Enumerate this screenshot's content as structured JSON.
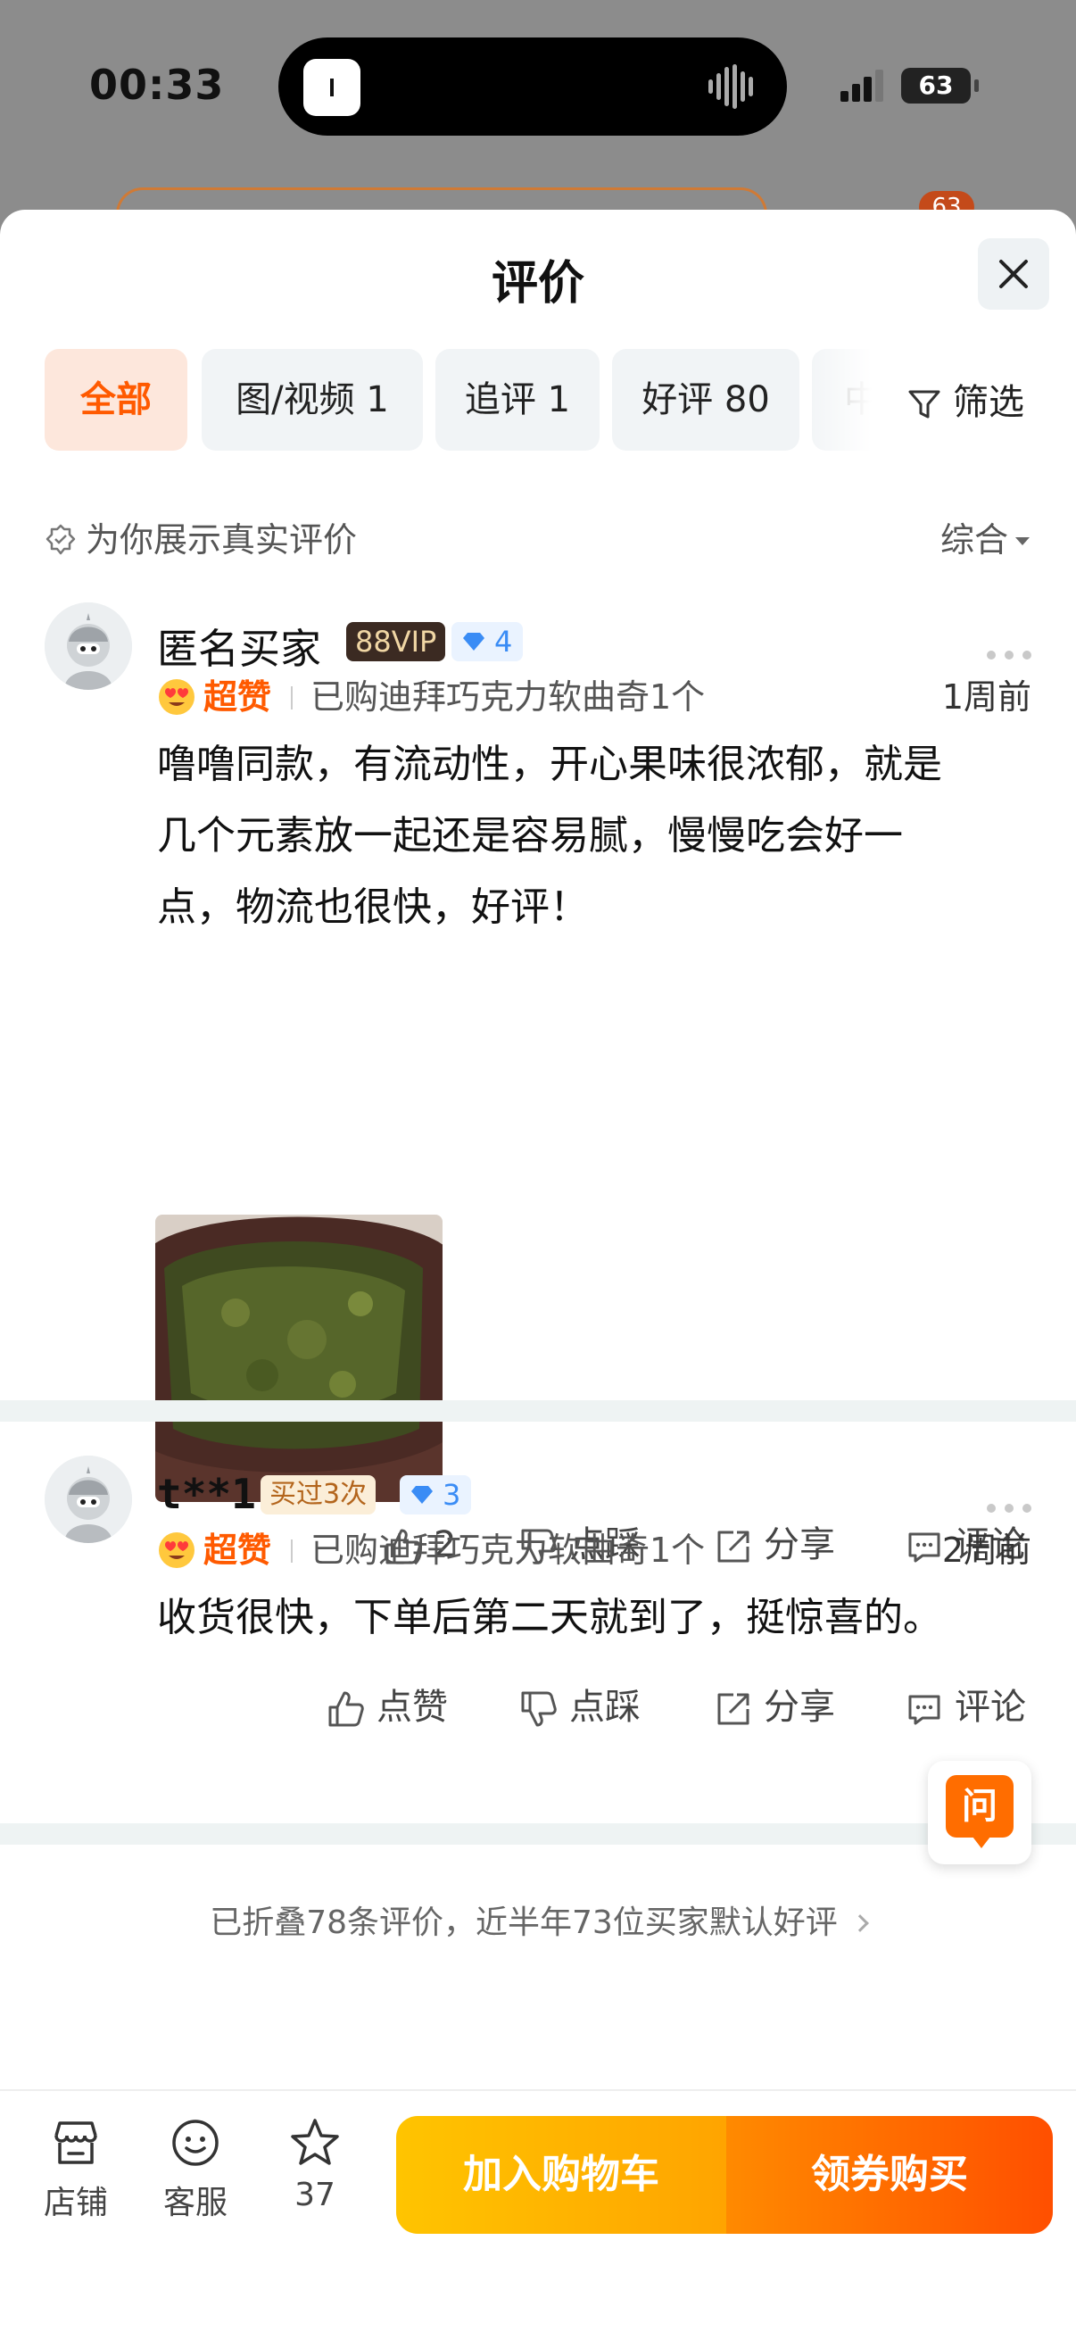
{
  "status_bar": {
    "time": "00:33",
    "battery": "63"
  },
  "background": {
    "cart_badge": "63"
  },
  "sheet": {
    "title": "评价"
  },
  "tabs": [
    {
      "label": "全部"
    },
    {
      "label": "图/视频 1"
    },
    {
      "label": "追评 1"
    },
    {
      "label": "好评 80"
    },
    {
      "label": "中"
    }
  ],
  "filter_label": "筛选",
  "info": {
    "text": "为你展示真实评价",
    "sort": "综合"
  },
  "reviews": [
    {
      "user": "匿名买家",
      "vip": "88VIP",
      "level": "4",
      "rating": "超赞",
      "purchase": "已购迪拜巧克力软曲奇1个",
      "when": "1周前",
      "lines": [
        "噜噜同款，有流动性，开心果味很浓郁，就是",
        "几个元素放一起还是容易腻，慢慢吃会好一",
        "点，物流也很快，好评！"
      ],
      "likes": "2",
      "dislike": "点踩",
      "share": "分享",
      "comment": "评论"
    },
    {
      "user": "t**1",
      "bought": "买过3次",
      "level": "3",
      "rating": "超赞",
      "purchase": "已购迪拜巧克力软曲奇1个",
      "when": "2周前",
      "lines": [
        "收货很快，下单后第二天就到了，挺惊喜的。"
      ],
      "like_label": "点赞",
      "dislike": "点踩",
      "share": "分享",
      "comment": "评论"
    }
  ],
  "folded": "已折叠78条评价，近半年73位买家默认好评",
  "ask": "问",
  "bottom": {
    "store": "店铺",
    "service": "客服",
    "favorites": "37",
    "add_cart": "加入购物车",
    "buy": "领券购买"
  },
  "colors": {
    "accent": "#ff5a00",
    "cart": "#ffb400",
    "buy": "#ff5a00"
  }
}
